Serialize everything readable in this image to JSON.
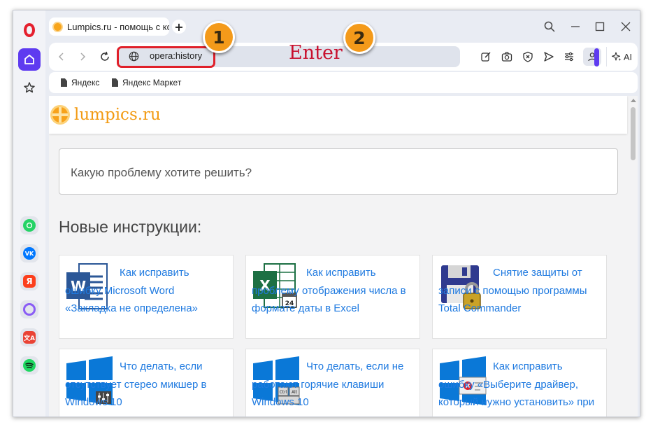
{
  "tab": {
    "title": "Lumpics.ru - помощь с ко"
  },
  "address_bar": {
    "url": "opera:history"
  },
  "ai_button": {
    "label": "AI"
  },
  "bookmarks": [
    {
      "label": "Яндекс"
    },
    {
      "label": "Яндекс Маркет"
    }
  ],
  "site": {
    "name": "lumpics.ru",
    "search_placeholder": "Какую проблему хотите решить?",
    "section_title": "Новые инструкции:",
    "articles": [
      {
        "title": "Как исправить ошибку Microsoft Word «Закладка не определена»",
        "icon": "word-icon"
      },
      {
        "title": "Как исправить проблему отображения числа в формате даты в Excel",
        "icon": "excel-icon"
      },
      {
        "title": "Снятие защиты от записи с помощью программы Total Commander",
        "icon": "floppy-lock-icon"
      },
      {
        "title": "Что делать, если отсутствует стерео микшер в Windows 10",
        "icon": "windows-mixer-icon"
      },
      {
        "title": "Что делать, если не работают горячие клавиши Windows 10",
        "icon": "windows-keyboard-icon"
      },
      {
        "title": "Как исправить ошибку «Выберите драйвер, который нужно установить» при",
        "icon": "windows-error-icon"
      }
    ]
  },
  "annotations": {
    "step1": "1",
    "step2": "2",
    "enter_text": "Enter"
  },
  "colors": {
    "accent": "#5e3bf0",
    "highlight": "#e0202a",
    "link": "#1f7ae0",
    "badge": "#f49a1a",
    "site_brand": "#f29a12"
  }
}
